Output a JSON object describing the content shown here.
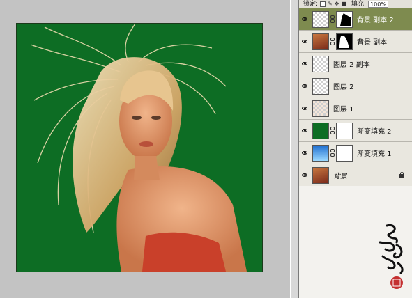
{
  "layers_panel": {
    "lock_label": "锁定:",
    "fill_label": "填充:",
    "fill_value": "100%",
    "layers": [
      {
        "name": "背景 副本 2",
        "selected": true
      },
      {
        "name": "背景 副本"
      },
      {
        "name": "图层 2 副本"
      },
      {
        "name": "图层 2"
      },
      {
        "name": "图层 1"
      },
      {
        "name": "渐变填充 2"
      },
      {
        "name": "渐变填充 1"
      },
      {
        "name": "背景",
        "italic": true,
        "locked": true
      }
    ]
  },
  "signature_text": "飛村艳 八"
}
